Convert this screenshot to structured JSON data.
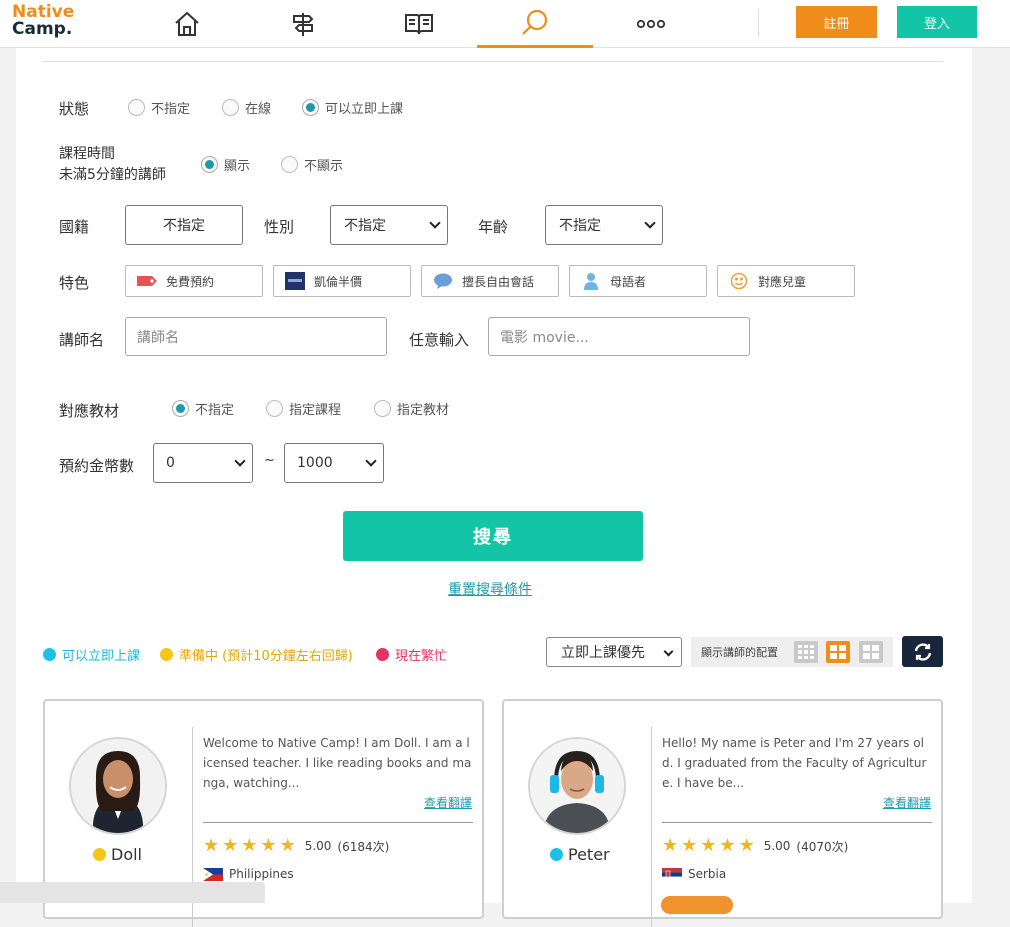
{
  "header": {
    "logo_line1": "Native",
    "logo_line2": "Camp.",
    "nav": [
      {
        "icon": "home-icon"
      },
      {
        "icon": "signpost-icon"
      },
      {
        "icon": "book-icon"
      },
      {
        "icon": "search-icon",
        "active": true
      },
      {
        "icon": "more-icon"
      }
    ],
    "register_label": "註冊",
    "login_label": "登入"
  },
  "filters": {
    "status": {
      "label": "狀態",
      "options": [
        "不指定",
        "在線",
        "可以立即上課"
      ],
      "selected": "可以立即上課"
    },
    "lesson_time": {
      "label_line1": "課程時間",
      "label_line2": "未滿5分鐘的講師",
      "options": [
        "顯示",
        "不顯示"
      ],
      "selected": "顯示"
    },
    "nationality": {
      "label": "國籍",
      "value": "不指定"
    },
    "gender": {
      "label": "性別",
      "value": "不指定"
    },
    "age": {
      "label": "年齡",
      "value": "不指定"
    },
    "features": {
      "label": "特色",
      "items": [
        {
          "label": "免費預約",
          "icon": "tag-icon"
        },
        {
          "label": "凱倫半價",
          "icon": "karen-icon"
        },
        {
          "label": "擅長自由會話",
          "icon": "chat-bubble-icon"
        },
        {
          "label": "母語者",
          "icon": "person-icon"
        },
        {
          "label": "對應兒童",
          "icon": "smiley-icon"
        }
      ]
    },
    "teacher_name": {
      "label": "講師名",
      "placeholder": "講師名"
    },
    "free_input": {
      "label": "任意輸入",
      "placeholder": "電影 movie..."
    },
    "material": {
      "label": "對應教材",
      "options": [
        "不指定",
        "指定課程",
        "指定教材"
      ],
      "selected": "不指定"
    },
    "coins": {
      "label": "預約金幣數",
      "min": "0",
      "separator": "~",
      "max": "1000"
    },
    "search_label": "搜尋",
    "reset_label": "重置搜尋條件"
  },
  "legend": [
    {
      "label": "可以立即上課",
      "color": "#1fc0e8"
    },
    {
      "label": "準備中 (預計10分鐘左右回歸)",
      "color": "#f5c518"
    },
    {
      "label": "現在繁忙",
      "color": "#e2355f"
    }
  ],
  "sort": {
    "value": "立即上課優先",
    "layout_label": "顯示講師的配置"
  },
  "teachers": [
    {
      "name": "Doll",
      "status_color": "#f5c518",
      "bio": "Welcome to Native Camp! I am Doll. I am a licensed teacher. I like reading books and manga, watching...",
      "translate_label": "查看翻譯",
      "rating": "5.00",
      "count": "(6184次)",
      "country": "Philippines"
    },
    {
      "name": "Peter",
      "status_color": "#1fc0e8",
      "bio": "Hello! My name is Peter and I'm 27 years old. I graduated from the Faculty of Agriculture. I have be...",
      "translate_label": "查看翻譯",
      "rating": "5.00",
      "count": "(4070次)",
      "country": "Serbia"
    }
  ]
}
